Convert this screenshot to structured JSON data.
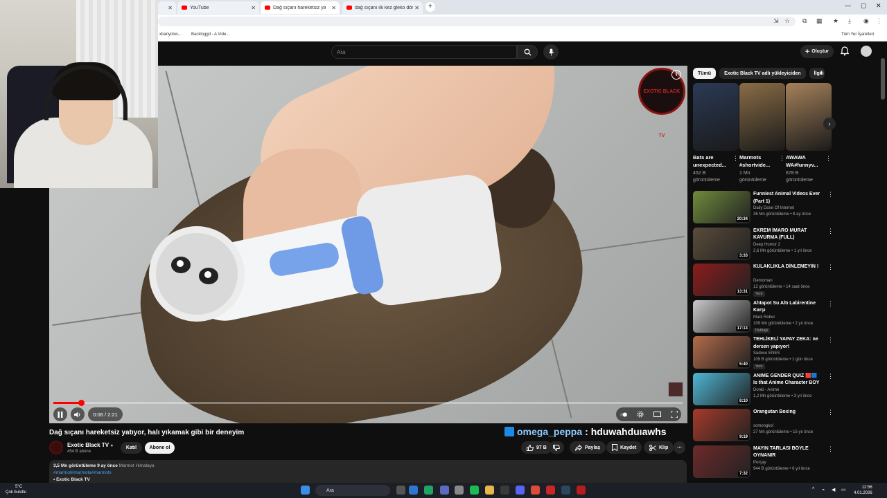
{
  "browser": {
    "tabs": [
      {
        "label": "YouTube"
      },
      {
        "label": "Dağ sıçanı hareketsiz yatıyor"
      },
      {
        "label": "dağ sıçanı ilk kez gleko döndü"
      }
    ],
    "bookmarks": [
      "xbanyolus...",
      "Backloggd - A Vide...",
      "Tüm Yer İşaretleri"
    ]
  },
  "header": {
    "search_placeholder": "Ara",
    "create_label": "Oluştur"
  },
  "player": {
    "channel_watermark": "EXOTIC BLACK TV",
    "time": "0:06 / 2:21",
    "progress": 0.044
  },
  "video": {
    "title": "Dağ sıçanı hareketsiz yatıyor, halı yıkamak gibi bir deneyim",
    "overlay_name": "omega_peppa",
    "overlay_msg": " : hduwahduıawhs",
    "channel": "Exotic Black TV",
    "subscribers": "454 B abone",
    "join_label": "Katıl",
    "subscribe_label": "Abone ol",
    "likes": "97 B",
    "share_label": "Paylaş",
    "save_label": "Kaydet",
    "clip_label": "Klip",
    "desc_stats": "3,5 Mn görüntüleme  9 ay önce",
    "desc_location": "Marmot Himalaya",
    "desc_tags": "#marmot#marmota#marmots",
    "desc_line3": "Exotic Black TV"
  },
  "sidebar": {
    "chips": [
      "Tümü",
      "Exotic Black TV adlı yükleyiciden",
      "İlgili"
    ],
    "shorts": [
      {
        "title": "Bats are unexpected...",
        "views": "452 B görüntüleme",
        "color": "#2b3a55"
      },
      {
        "title": "Marmots #shortvide...",
        "views": "1 Mn görüntüleme",
        "color": "#8a6d46"
      },
      {
        "title": "AWAWA WA#funnyv...",
        "views": "678 B görüntüleme",
        "color": "#a5825a"
      }
    ],
    "recs": [
      {
        "title": "Funniest Animal Videos Ever (Part 1)",
        "channel": "Daily Dose Of Internet",
        "meta": "36 Mn görüntüleme • 8 ay önce",
        "duration": "20:34",
        "color": "#6f8b3c",
        "badge": ""
      },
      {
        "title": "EKREM İMARO MURAT KAVURMA (FULL)",
        "channel": "Deep Humor 2",
        "meta": "2,6 Mn görüntüleme • 1 yıl önce",
        "duration": "3:33",
        "color": "#5a4c3a",
        "badge": ""
      },
      {
        "title": "KULAKLIKLA DİNLEMEYİN !",
        "channel": "Demoman",
        "meta": "12 görüntüleme • 14 saat önce",
        "duration": "13:31",
        "color": "#8c1c1c",
        "badge": "Yeni"
      },
      {
        "title": "Ahtapot Su Altı Labirentine Karşı",
        "channel": "Mark Rober",
        "meta": "109 Mn görüntüleme • 2 yıl önce",
        "duration": "17:13",
        "color": "#c9c9c9",
        "badge": "Dublajlı"
      },
      {
        "title": "TEHLİKELİ YAPAY ZEKA: ne dersen yapıyor!",
        "channel": "Sadece ENES",
        "meta": "109 B görüntüleme • 1 gün önce",
        "duration": "5:40",
        "color": "#b46b4a",
        "badge": "Yeni"
      },
      {
        "title": "ANIME GENDER QUIZ 🟥🟦 Is that Anime Character BOY or ...",
        "channel": "Donki - Anime",
        "meta": "1,2 Mn görüntüleme • 3 yıl önce",
        "duration": "8:10",
        "color": "#4fb7d6",
        "badge": ""
      },
      {
        "title": "Orangutan Boxing",
        "channel": "somongkol",
        "meta": "27 Mn görüntüleme • 15 yıl önce",
        "duration": "9:19",
        "color": "#a63a2a",
        "badge": ""
      },
      {
        "title": "MAYIN TARLASI BÖYLE OYNANIR",
        "channel": "Porçay",
        "meta": "944 B görüntüleme • 6 yıl önce",
        "duration": "7:32",
        "color": "#6e2a2a",
        "badge": ""
      }
    ]
  },
  "taskbar": {
    "weather_temp": "5°C",
    "weather_desc": "Çok bulutlu",
    "search_label": "Ara",
    "time": "12:56",
    "date": "4.01.2026"
  },
  "colors": {
    "accent": "#ff0000",
    "background": "#0f0f0f",
    "surface": "#272727"
  }
}
